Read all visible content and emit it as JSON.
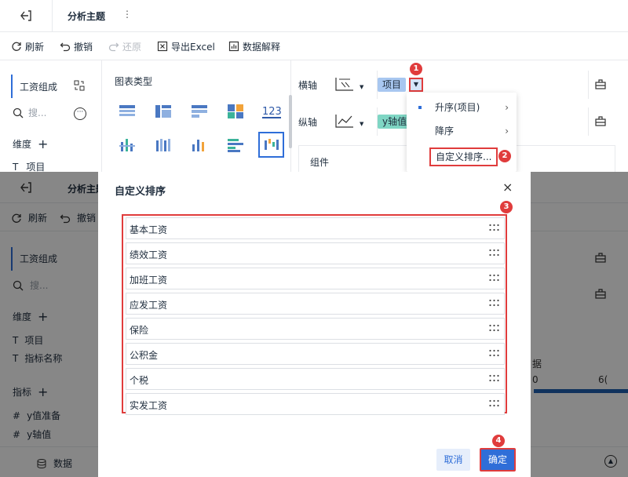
{
  "app": {
    "title": "分析主题",
    "more": "⋮"
  },
  "toolbar": {
    "refresh": "刷新",
    "undo": "撤销",
    "redo": "还原",
    "export": "导出Excel",
    "explain": "数据解释"
  },
  "left": {
    "tab": "工资组成",
    "search_placeholder": "搜...",
    "dimension_label": "维度",
    "dim_items": [
      "项目",
      "指标名称"
    ],
    "indicator_label": "指标",
    "indicator_items": [
      "y值准备",
      "y轴值"
    ],
    "data_tab": "数据"
  },
  "chartpanel": {
    "label": "图表类型",
    "icon_123": "123"
  },
  "config": {
    "x_axis": "横轴",
    "x_pill": "项目",
    "y_axis": "纵轴",
    "y_pill": "y轴值",
    "component": "组件"
  },
  "dropdown": {
    "items": [
      {
        "label": "升序(项目)",
        "has_arrow": true,
        "selected": true
      },
      {
        "label": "降序",
        "has_arrow": true,
        "selected": false
      },
      {
        "label": "自定义排序...",
        "has_arrow": false,
        "selected": false
      }
    ]
  },
  "badges": [
    "1",
    "2",
    "3",
    "4"
  ],
  "lower_fragments": {
    "right_text": "据",
    "axis_left": "0",
    "axis_right": "6("
  },
  "modal": {
    "title": "自定义排序",
    "close": "×",
    "items": [
      "基本工资",
      "绩效工资",
      "加班工资",
      "应发工资",
      "保险",
      "公积金",
      "个税",
      "实发工资"
    ],
    "cancel": "取消",
    "ok": "确定"
  },
  "colors": {
    "accent": "#2f6ed8",
    "highlight": "#e03c3c",
    "pill_blue": "#a8c7f0",
    "pill_teal": "#7fd6c4"
  }
}
